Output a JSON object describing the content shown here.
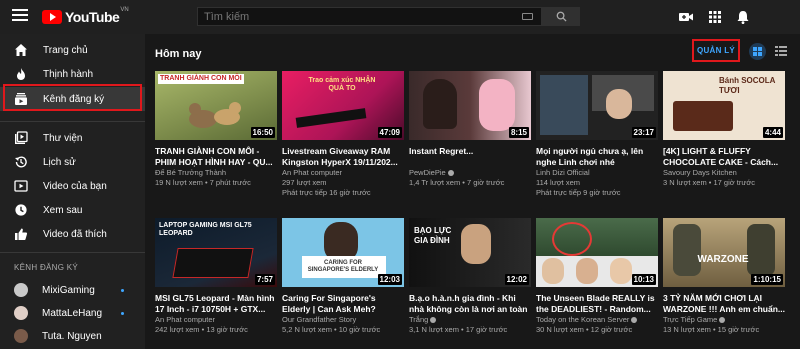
{
  "app": {
    "logo_text": "YouTube",
    "logo_country": "VN"
  },
  "search": {
    "placeholder": "Tìm kiếm"
  },
  "sidebar": {
    "items": [
      {
        "label": "Trang chủ",
        "icon": "home-icon"
      },
      {
        "label": "Thịnh hành",
        "icon": "flame-icon"
      },
      {
        "label": "Kênh đăng ký",
        "icon": "subscriptions-icon"
      },
      {
        "label": "Thư viện",
        "icon": "library-icon"
      },
      {
        "label": "Lịch sử",
        "icon": "history-icon"
      },
      {
        "label": "Video của bạn",
        "icon": "play-icon"
      },
      {
        "label": "Xem sau",
        "icon": "clock-icon"
      },
      {
        "label": "Video đã thích",
        "icon": "thumbs-up-icon"
      }
    ],
    "subs_title": "KÊNH ĐĂNG KÝ",
    "subs": [
      {
        "name": "MixiGaming",
        "avatar_color": "#c9c9c9"
      },
      {
        "name": "MattaLeHang",
        "avatar_color": "#e0cfc7"
      },
      {
        "name": "Tuta. Nguyen",
        "avatar_color": "#7a5b4a"
      }
    ]
  },
  "main": {
    "section_title": "Hôm nay",
    "manage_label": "QUẢN LÝ"
  },
  "videos": [
    {
      "title": "TRANH GIÀNH CON MÔI - PHIM HOẠT HÌNH HAY - QU...",
      "channel": "Để Bé Trưởng Thành",
      "verified": false,
      "meta": "19 N lượt xem • 7 phút trước",
      "extra": "",
      "duration": "16:50",
      "thumb_text": "TRANH GIÀNH CON MÔI",
      "bg": "#8a9a5b"
    },
    {
      "title": "Livestream Giveaway RAM Kingston HyperX 19/11/202...",
      "channel": "An Phat computer",
      "verified": false,
      "meta": "297 lượt xem",
      "extra": "Phát trực tiếp 16 giờ trước",
      "duration": "47:09",
      "thumb_text": "Trao cảm xúc NHẬN QUÀ TO",
      "bg": "#c2185b"
    },
    {
      "title": "Instant Regret...",
      "channel": "PewDiePie",
      "verified": true,
      "meta": "1,4 Tr lượt xem • 7 giờ trước",
      "extra": "",
      "duration": "8:15",
      "thumb_text": "",
      "bg": "#3a2a2a"
    },
    {
      "title": "Mọi người ngủ chưa ạ, lên nghe Linh chơi nhé",
      "channel": "Linh Dizi Official",
      "verified": false,
      "meta": "114 lượt xem",
      "extra": "Phát trực tiếp 9 giờ trước",
      "duration": "23:17",
      "thumb_text": "",
      "bg": "#2b2b2b"
    },
    {
      "title": "[4K] LIGHT & FLUFFY CHOCOLATE CAKE - Cách...",
      "channel": "Savoury Days Kitchen",
      "verified": false,
      "meta": "3 N lượt xem • 17 giờ trước",
      "extra": "",
      "duration": "4:44",
      "thumb_text": "Bánh SOCOLA TƯƠI",
      "bg": "#e8d8c4"
    },
    {
      "title": "MSI GL75 Leopard - Màn hình 17 Inch - i7 10750H + GTX...",
      "channel": "An Phat computer",
      "verified": false,
      "meta": "242 lượt xem • 13 giờ trước",
      "extra": "",
      "duration": "7:57",
      "thumb_text": "LAPTOP GAMING MSI GL75 LEOPARD",
      "bg": "#101820"
    },
    {
      "title": "Caring For Singapore's Elderly | Can Ask Meh?",
      "channel": "Our Grandfather Story",
      "verified": false,
      "meta": "5,2 N lượt xem • 10 giờ trước",
      "extra": "",
      "duration": "12:03",
      "thumb_text": "CARING FOR SINGAPORE'S ELDERLY",
      "bg": "#78c4e8"
    },
    {
      "title": "B.ạ.o h.à.n.h gia đình - Khi nhà không còn là nơi an toàn",
      "channel": "Trắng",
      "verified": true,
      "meta": "3,1 N lượt xem • 17 giờ trước",
      "extra": "",
      "duration": "12:02",
      "thumb_text": "BẠO LỰC GIA ĐÌNH",
      "bg": "#1c1c1c"
    },
    {
      "title": "The Unseen Blade REALLY is the DEADLIEST! - Random...",
      "channel": "Today on the Korean Server",
      "verified": true,
      "meta": "30 N lượt xem • 12 giờ trước",
      "extra": "",
      "duration": "10:13",
      "thumb_text": "",
      "bg": "#3d5a3d"
    },
    {
      "title": "3 TỶ NĂM MỚI CHƠI LẠI WARZONE !!! Anh em chuẩn...",
      "channel": "Trực Tiếp Game",
      "verified": true,
      "meta": "13 N lượt xem • 15 giờ trước",
      "extra": "",
      "duration": "1:10:15",
      "thumb_text": "WARZONE",
      "bg": "#8a7a5a"
    }
  ],
  "colors": {
    "accent": "#3ea6ff",
    "highlight": "#e0181c",
    "brand": "#ff0000"
  }
}
